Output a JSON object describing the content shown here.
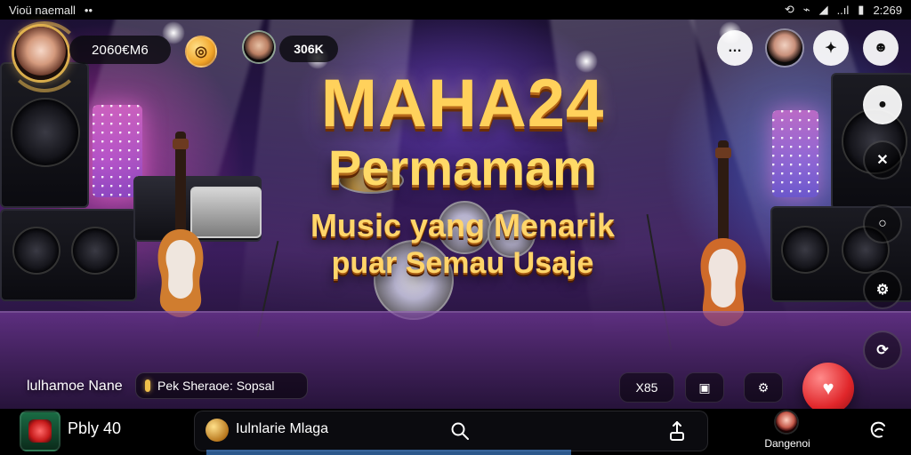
{
  "status_bar": {
    "left_text": "Vioü naemall",
    "left_dots": "••",
    "right_time": "2:269",
    "right_extra": "..ıl",
    "signal_icon": "signal-icon",
    "wifi_icon": "wifi-icon",
    "battery_icon": "battery-icon"
  },
  "top_hud": {
    "coins_text": "2060€M6",
    "coin_button_icon": "coin-icon",
    "viewer_count": "306K"
  },
  "title": {
    "line1": "MAHA24",
    "line2": "Permamam",
    "line3": "Music yang Menarik",
    "line4": "puar Semau Usaje"
  },
  "bottom_overlay": {
    "left_name": "lulhamoe Nane",
    "speaker_chip_text": "Pek Sheraoe: Sopsal",
    "num_pill": "X85"
  },
  "bottom_bar": {
    "left_text": "Pbly 40",
    "center_text": "Iulnlarie Mlaga",
    "right_label": "Dangenoi"
  },
  "colors": {
    "gold": "#ffd15b",
    "record_red": "#e0262a"
  }
}
